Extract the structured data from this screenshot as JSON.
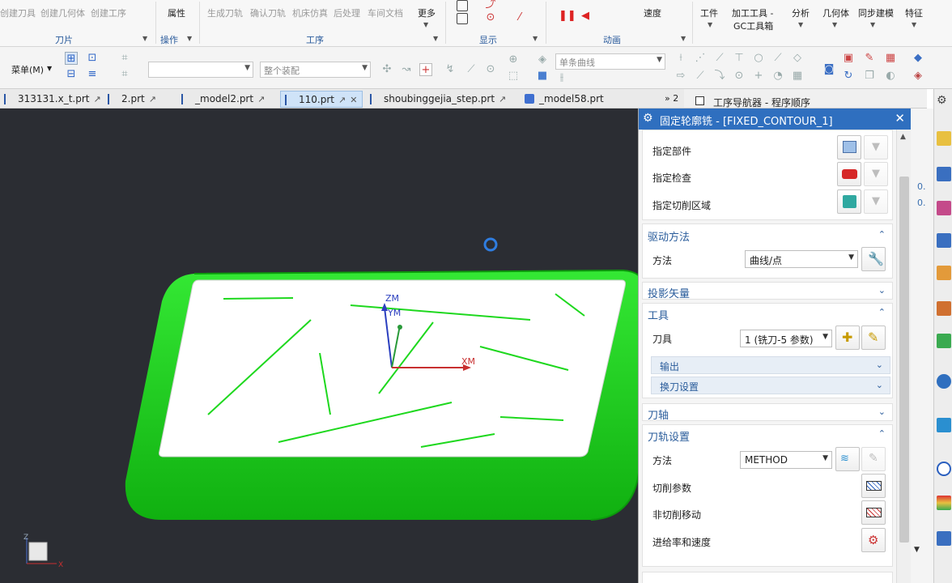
{
  "ribbon": {
    "buttons": {
      "create_tool": "创建刀具",
      "create_geometry": "创建几何体",
      "create_operation": "创建工序",
      "properties": "属性",
      "generate_path": "生成刀轨",
      "verify_path": "确认刀轨",
      "machine_sim": "机床仿真",
      "postprocess": "后处理",
      "shop_doc": "车间文档",
      "more": "更多",
      "speed": "速度",
      "tools": "工件",
      "gc_toolbox_1": "加工工具 -",
      "gc_toolbox_2": "GC工具箱",
      "analysis": "分析",
      "geometry": "几何体",
      "sync_model": "同步建模",
      "feature": "特征"
    },
    "groups": {
      "insert": "刀片",
      "operation": "操作",
      "process": "工序",
      "display": "显示",
      "animation": "动画"
    }
  },
  "toolbar2": {
    "menu_label": "菜单(M)",
    "filter_placeholder": "",
    "assembly_filter": "整个装配",
    "curve_rule": "单条曲线"
  },
  "tabs": [
    {
      "label": "313131.x_t.prt"
    },
    {
      "label": "2.prt"
    },
    {
      "label": "_model2.prt"
    },
    {
      "label": "110.prt"
    },
    {
      "label": "shoubinggejia_step.prt"
    },
    {
      "label": "_model58.prt"
    }
  ],
  "tab_overflow": "» 2",
  "navigator": {
    "title": "工序导航器 - 程序顺序"
  },
  "viewport": {
    "axis_zm": "ZM",
    "axis_ym": "YM",
    "axis_xm": "XM",
    "triad_z": "Z",
    "triad_x": "X"
  },
  "dialog": {
    "title": "固定轮廓铣 - [FIXED_CONTOUR_1]",
    "geometry": {
      "specify_part": "指定部件",
      "specify_check": "指定检查",
      "specify_cut_area": "指定切削区域"
    },
    "drive_method": {
      "header": "驱动方法",
      "method_label": "方法",
      "method_value": "曲线/点"
    },
    "projection_vector": {
      "header": "投影矢量"
    },
    "tool": {
      "header": "工具",
      "tool_label": "刀具",
      "tool_value": "1 (铣刀-5 参数)",
      "output": "输出",
      "tool_change": "换刀设置"
    },
    "tool_axis": {
      "header": "刀轴"
    },
    "path_settings": {
      "header": "刀轨设置",
      "method_label": "方法",
      "method_value": "METHOD",
      "cut_params": "切削参数",
      "non_cut_moves": "非切削移动",
      "feeds_speeds": "进给率和速度"
    }
  },
  "side_values": [
    "0.",
    "0."
  ]
}
